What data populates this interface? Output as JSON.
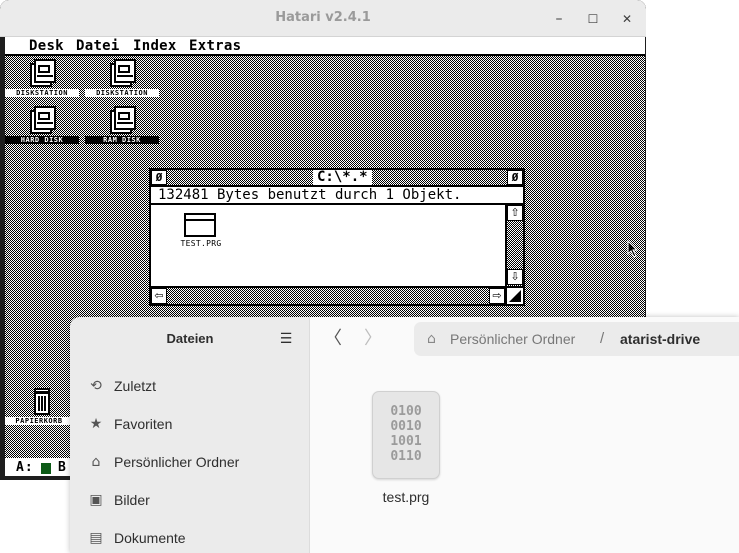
{
  "hatari": {
    "title": "Hatari v2.4.1",
    "controls": {
      "minimize": "–",
      "maximize": "☐",
      "close": "✕"
    }
  },
  "atari": {
    "menu": [
      "Desk",
      "Datei",
      "Index",
      "Extras"
    ],
    "desktop_icons": [
      "DISKSTATION",
      "DISKSTATION",
      "HARD DISK",
      "RAM DISK",
      "PAPIERKORB"
    ],
    "window": {
      "title": "C:\\*.*",
      "closer": "Ø",
      "fuller": "Ø",
      "info": "132481 Bytes benutzt durch 1 Objekt.",
      "file": "TEST.PRG",
      "scroll_up": "⇧",
      "scroll_down": "⇩",
      "scroll_left": "⇦",
      "scroll_right": "⇨"
    },
    "status": {
      "drive_a": "A:",
      "drive_b": "B"
    }
  },
  "files": {
    "sidebar_title": "Dateien",
    "sidebar_items": [
      {
        "label": "Zuletzt",
        "icon": "clock-icon",
        "glyph": "⟲"
      },
      {
        "label": "Favoriten",
        "icon": "star-icon",
        "glyph": "★"
      },
      {
        "label": "Persönlicher Ordner",
        "icon": "home-icon",
        "glyph": "⌂"
      },
      {
        "label": "Bilder",
        "icon": "image-icon",
        "glyph": "▣"
      },
      {
        "label": "Dokumente",
        "icon": "document-icon",
        "glyph": "▤"
      }
    ],
    "path": {
      "home": "Persönlicher Ordner",
      "separator": "/",
      "current": "atarist-drive"
    },
    "nav": {
      "back": "〈",
      "forward": "〉"
    },
    "file": {
      "name": "test.prg",
      "thumb": "0100\n0010\n1001\n0110"
    }
  },
  "colors": {
    "led": "#0d5b17",
    "sidebar_bg": "#ebebeb",
    "hatari_titlebar": "#ebebeb"
  }
}
